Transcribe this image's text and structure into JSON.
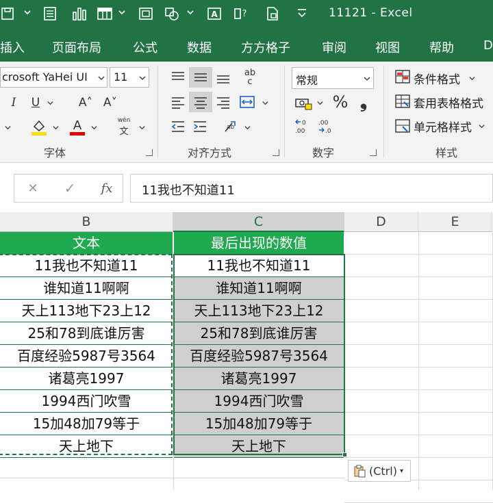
{
  "window": {
    "title": "11121  -  Excel"
  },
  "tabs": [
    "插入",
    "页面布局",
    "公式",
    "数据",
    "方方格子",
    "审阅",
    "视图",
    "帮助",
    "D"
  ],
  "ribbon": {
    "font_name": "crosoft YaHei UI",
    "font_size": "11",
    "number_format": "常规",
    "percent_symbol": "%",
    "comma_symbol": "❟",
    "bold_like": "I",
    "underline": "U",
    "grow_font": "A˄",
    "shrink_font": "A˅",
    "font_color_glyph": "A",
    "wen_label": "wén",
    "wen_char": "文",
    "ab_label": "ab",
    "ab_c": "c",
    "cond_format": "条件格式",
    "table_format": "套用表格格式",
    "cell_style": "单元格样式",
    "group_font": "字体",
    "group_align": "对齐方式",
    "group_number": "数字",
    "group_styles": "样式"
  },
  "formula_bar": {
    "cancel": "✕",
    "confirm": "✓",
    "fx": "fx",
    "content": "11我也不知道11"
  },
  "columns": [
    "B",
    "C",
    "D",
    "E"
  ],
  "table": {
    "header_b": "文本",
    "header_c": "最后出现的数值",
    "rows_b": [
      "11我也不知道11",
      "谁知道11啊啊",
      "天上113地下23上12",
      "25和78到底谁厉害",
      "百度经验5987号3564",
      "诸葛亮1997",
      "1994西门吹雪",
      "15加48加79等于",
      "天上地下"
    ],
    "rows_c": [
      "11我也不知道11",
      "谁知道11啊啊",
      "天上113地下23上12",
      "25和78到底谁厉害",
      "百度经验5987号3564",
      "诸葛亮1997",
      "1994西门吹雪",
      "15加48加79等于",
      "天上地下"
    ]
  },
  "paste_options": {
    "label": "(Ctrl)"
  },
  "colors": {
    "excel_green": "#217346",
    "header_green": "#1faa4f",
    "selection_gray": "#cfcfcf"
  }
}
